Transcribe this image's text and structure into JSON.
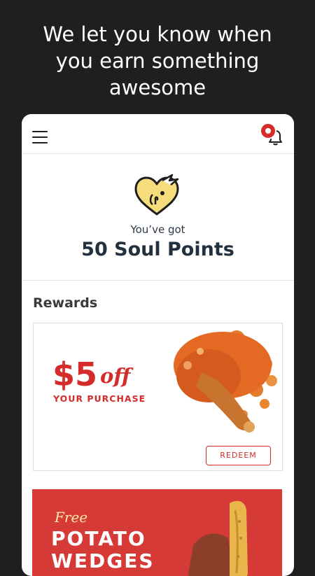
{
  "headline": {
    "line1": "We let you know when",
    "line2": "you earn something",
    "line3": "awesome"
  },
  "topbar": {
    "menu_icon": "hamburger-menu-icon",
    "bell_icon": "bell-icon",
    "notification_badge": true
  },
  "points": {
    "intro": "You’ve got",
    "value_label": "50 Soul Points"
  },
  "rewards": {
    "title": "Rewards",
    "items": [
      {
        "amount": "$5",
        "suffix": "off",
        "subtitle": "YOUR PURCHASE",
        "button_label": "REDEEM"
      },
      {
        "prefix": "Free",
        "line1": "POTATO",
        "line2": "WEDGES"
      }
    ]
  },
  "colors": {
    "accent": "#d52b2b",
    "background": "#1f1f1f",
    "heart_yellow": "#f6dc7a",
    "promo_red": "#d63a36"
  }
}
